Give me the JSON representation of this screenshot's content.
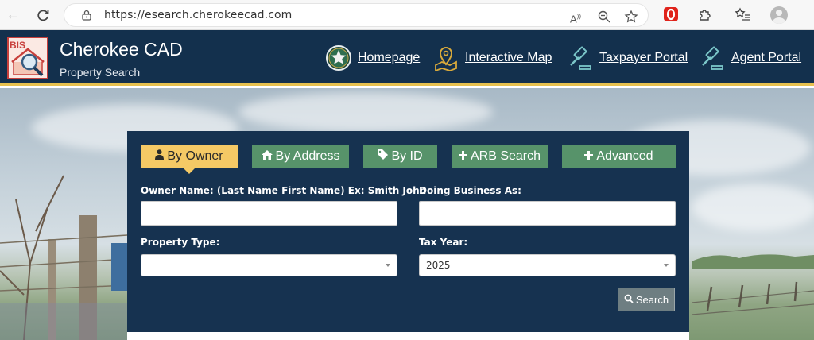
{
  "browser": {
    "url": "https://esearch.cherokeecad.com"
  },
  "header": {
    "logo_text": "BIS",
    "title": "Cherokee CAD",
    "subtitle": "Property Search",
    "nav": [
      {
        "label": "Homepage",
        "icon": "texas-star-icon"
      },
      {
        "label": "Interactive Map",
        "icon": "map-pin-icon"
      },
      {
        "label": "Taxpayer Portal",
        "icon": "gavel-icon"
      },
      {
        "label": "Agent Portal",
        "icon": "gavel-icon"
      }
    ]
  },
  "search": {
    "tabs": [
      {
        "label": "By Owner",
        "icon": "user-icon",
        "active": true
      },
      {
        "label": "By Address",
        "icon": "home-icon",
        "active": false
      },
      {
        "label": "By ID",
        "icon": "tag-icon",
        "active": false
      },
      {
        "label": "ARB Search",
        "icon": "plus-icon",
        "active": false
      },
      {
        "label": "Advanced",
        "icon": "plus-icon",
        "active": false
      }
    ],
    "owner_name_label": "Owner Name: (Last Name First Name) Ex: Smith John",
    "owner_name_value": "",
    "dba_label": "Doing Business As:",
    "dba_value": "",
    "property_type_label": "Property Type:",
    "property_type_value": "",
    "tax_year_label": "Tax Year:",
    "tax_year_value": "2025",
    "search_label": "Search"
  },
  "colors": {
    "header_bg": "#13304d",
    "panel_bg": "#163250",
    "tab_green": "#57936a",
    "tab_active": "#f5c965",
    "accent_gold": "#e7c14f"
  }
}
